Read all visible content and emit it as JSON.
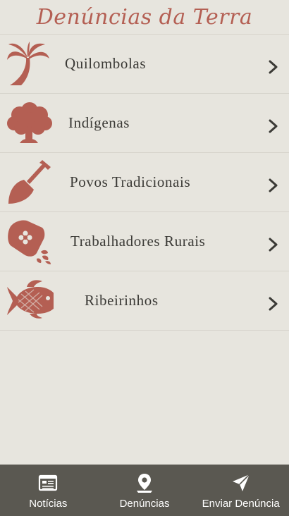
{
  "app": {
    "title": "Denúncias da Terra"
  },
  "colors": {
    "accent": "#b45f53",
    "background": "#e7e5de",
    "nav_background": "#5a5851"
  },
  "categories": [
    {
      "label": "Quilombolas",
      "icon": "palm-tree-icon"
    },
    {
      "label": "Indígenas",
      "icon": "tree-icon"
    },
    {
      "label": "Povos Tradicionais",
      "icon": "shovel-icon"
    },
    {
      "label": "Trabalhadores Rurais",
      "icon": "seed-bag-icon"
    },
    {
      "label": "Ribeirinhos",
      "icon": "fish-icon"
    }
  ],
  "bottom_nav": [
    {
      "label": "Notícias",
      "icon": "newspaper-icon"
    },
    {
      "label": "Denúncias",
      "icon": "map-pin-icon"
    },
    {
      "label": "Enviar Denúncia",
      "icon": "send-icon"
    }
  ]
}
